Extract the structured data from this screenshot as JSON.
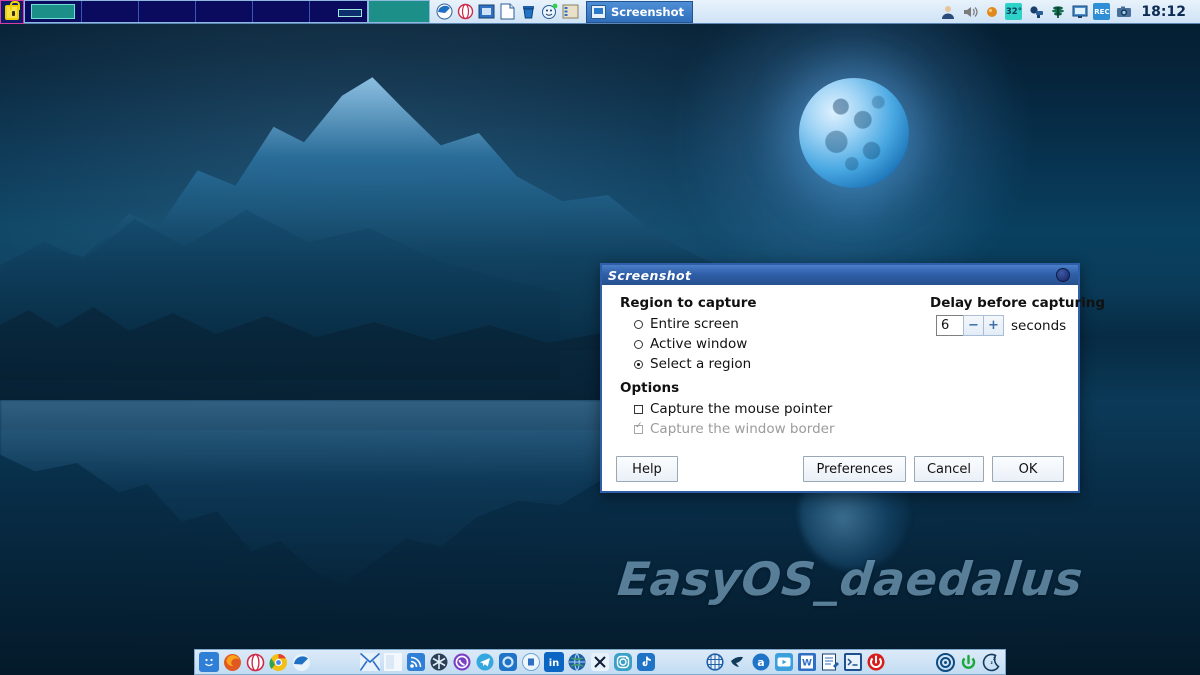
{
  "desktop": {
    "wallpaper_text": "EasyOS_daedalus"
  },
  "topbar": {
    "lock_icon": "padlock-icon",
    "workspaces": [
      {
        "name": "workspace-1",
        "active": true
      },
      {
        "name": "workspace-2",
        "active": false
      },
      {
        "name": "workspace-3",
        "active": false
      },
      {
        "name": "workspace-4",
        "active": false
      },
      {
        "name": "workspace-5",
        "active": false
      },
      {
        "name": "workspace-6",
        "active": false
      }
    ],
    "launchers": [
      {
        "name": "blueball-launcher-icon",
        "glyph": "◖"
      },
      {
        "name": "opera-launcher-icon",
        "glyph": "◯"
      },
      {
        "name": "screenshot-launcher-icon",
        "glyph": "❑"
      },
      {
        "name": "text-document-icon",
        "glyph": "□"
      },
      {
        "name": "paint-bucket-icon",
        "glyph": "▬"
      },
      {
        "name": "smiley-help-icon",
        "glyph": "☺"
      },
      {
        "name": "filemanager-icon",
        "glyph": "☰"
      }
    ],
    "task": {
      "icon": "screenshot-window-icon",
      "label": "Screenshot"
    },
    "tray": [
      {
        "name": "user-account-icon",
        "glyph": "👤"
      },
      {
        "name": "volume-icon",
        "glyph": "🔊"
      },
      {
        "name": "orange-dot-icon",
        "glyph": "●"
      },
      {
        "name": "temperature-icon",
        "label": "32°"
      },
      {
        "name": "printer-icon",
        "glyph": "⎙"
      },
      {
        "name": "network-tower-icon",
        "glyph": "☖"
      },
      {
        "name": "display-icon",
        "glyph": "⎕"
      },
      {
        "name": "record-icon",
        "label": "REC"
      },
      {
        "name": "camera-icon",
        "glyph": "📷"
      }
    ],
    "clock": "18:12"
  },
  "dock": {
    "group1": [
      {
        "name": "finder-icon",
        "glyph": "☺",
        "color": "#2f7fd6"
      },
      {
        "name": "firefox-icon",
        "glyph": "●",
        "color": "#e25822"
      },
      {
        "name": "opera-icon",
        "glyph": "O",
        "color": "#ffffff"
      },
      {
        "name": "chrome-icon",
        "glyph": "●",
        "color": "#f5c518"
      },
      {
        "name": "blueball-icon",
        "glyph": "◖",
        "color": "#1f6fc4"
      }
    ],
    "group2": [
      {
        "name": "mail-icon",
        "glyph": "✉",
        "color": "#ffffff"
      },
      {
        "name": "white-square-icon",
        "glyph": "◧",
        "color": "#ffffff"
      },
      {
        "name": "rss-feed-icon",
        "glyph": "◔",
        "color": "#2f7fd6"
      },
      {
        "name": "snowflake-icon",
        "glyph": "✳",
        "color": "#2b3f55"
      },
      {
        "name": "whatsapp-icon",
        "glyph": "✆",
        "color": "#7b3fc4"
      },
      {
        "name": "telegram-icon",
        "glyph": "➤",
        "color": "#2f9fe0"
      },
      {
        "name": "openai-icon",
        "glyph": "❁",
        "color": "#1f74c8"
      },
      {
        "name": "circle-app-icon",
        "glyph": "Ⓘ",
        "color": "#eef6fd"
      },
      {
        "name": "linkedin-icon",
        "glyph": "in",
        "color": "#0a66c2"
      },
      {
        "name": "globe-browser-icon",
        "glyph": "🌐",
        "color": "#1f5fa8"
      },
      {
        "name": "x-twitter-icon",
        "glyph": "X",
        "color": "#0d1b33"
      },
      {
        "name": "instagram-icon",
        "glyph": "▢",
        "color": "#3aa0c8"
      },
      {
        "name": "tiktok-icon",
        "glyph": "♪",
        "color": "#1f74c8"
      }
    ],
    "group3": [
      {
        "name": "grid-globe-icon",
        "glyph": "⊕",
        "color": "#1f5fa8"
      },
      {
        "name": "bird-icon",
        "glyph": "➦",
        "color": "#123a5c"
      },
      {
        "name": "amazon-icon",
        "glyph": "a",
        "color": "#1f74c8"
      },
      {
        "name": "youtube-icon",
        "glyph": "▶",
        "color": "#3ba0dc"
      },
      {
        "name": "word-document-icon",
        "glyph": "W",
        "color": "#2f6fc4"
      },
      {
        "name": "notepad-icon",
        "glyph": "✎",
        "color": "#ffffff"
      },
      {
        "name": "terminal-icon",
        "glyph": "⌫",
        "color": "#1f4f8f"
      },
      {
        "name": "power-off-icon",
        "glyph": "⏻",
        "color": "#d81b1b"
      }
    ],
    "group4": [
      {
        "name": "target-icon",
        "glyph": "◎",
        "color": "#0d4c82"
      },
      {
        "name": "restart-power-icon",
        "glyph": "⏻",
        "color": "#19a83a"
      },
      {
        "name": "sleep-moon-icon",
        "glyph": "☾",
        "color": "#123a5c"
      }
    ]
  },
  "dialog": {
    "title": "Screenshot",
    "region_group_label": "Region to capture",
    "region_options": [
      {
        "label": "Entire screen",
        "selected": false
      },
      {
        "label": "Active window",
        "selected": false
      },
      {
        "label": "Select a region",
        "selected": true
      }
    ],
    "options_group_label": "Options",
    "checkbox_options": [
      {
        "label": "Capture the mouse pointer",
        "checked": false,
        "disabled": false
      },
      {
        "label": "Capture the window border",
        "checked": true,
        "disabled": true
      }
    ],
    "delay_label": "Delay before capturing",
    "delay_value": "6",
    "delay_decrement": "−",
    "delay_increment": "+",
    "delay_units": "seconds",
    "buttons": {
      "help": "Help",
      "preferences": "Preferences",
      "cancel": "Cancel",
      "ok": "OK"
    }
  }
}
